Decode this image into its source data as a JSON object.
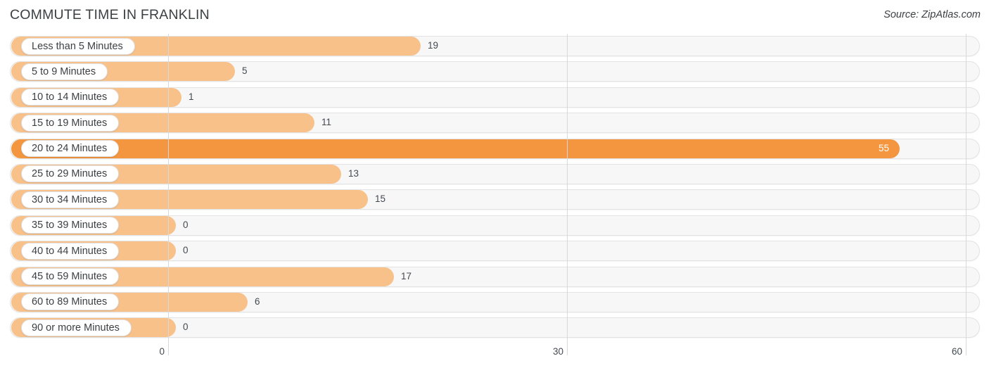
{
  "header": {
    "title": "COMMUTE TIME IN FRANKLIN",
    "source": "Source: ZipAtlas.com"
  },
  "colors": {
    "bar": "#f8c18a",
    "bar_max": "#f3963f",
    "track": "#f7f7f7",
    "track_border": "#e3e3e3",
    "grid": "#d8d8d8",
    "text": "#3c4043"
  },
  "chart_data": {
    "type": "bar",
    "orientation": "horizontal",
    "title": "COMMUTE TIME IN FRANKLIN",
    "subtitle": "",
    "xlabel": "",
    "ylabel": "",
    "xlim": [
      0,
      60
    ],
    "grid": true,
    "legend": "none",
    "source": "Source: ZipAtlas.com",
    "xticks": [
      "0",
      "30",
      "60"
    ],
    "xtick_values": [
      0,
      30,
      60
    ],
    "categories": [
      "Less than 5 Minutes",
      "5 to 9 Minutes",
      "10 to 14 Minutes",
      "15 to 19 Minutes",
      "20 to 24 Minutes",
      "25 to 29 Minutes",
      "30 to 34 Minutes",
      "35 to 39 Minutes",
      "40 to 44 Minutes",
      "45 to 59 Minutes",
      "60 to 89 Minutes",
      "90 or more Minutes"
    ],
    "values": [
      19,
      5,
      1,
      11,
      55,
      13,
      15,
      0,
      0,
      17,
      6,
      0
    ],
    "value_labels": [
      "19",
      "5",
      "1",
      "11",
      "55",
      "13",
      "15",
      "0",
      "0",
      "17",
      "6",
      "0"
    ],
    "max_value": 55,
    "max_index": 4
  }
}
